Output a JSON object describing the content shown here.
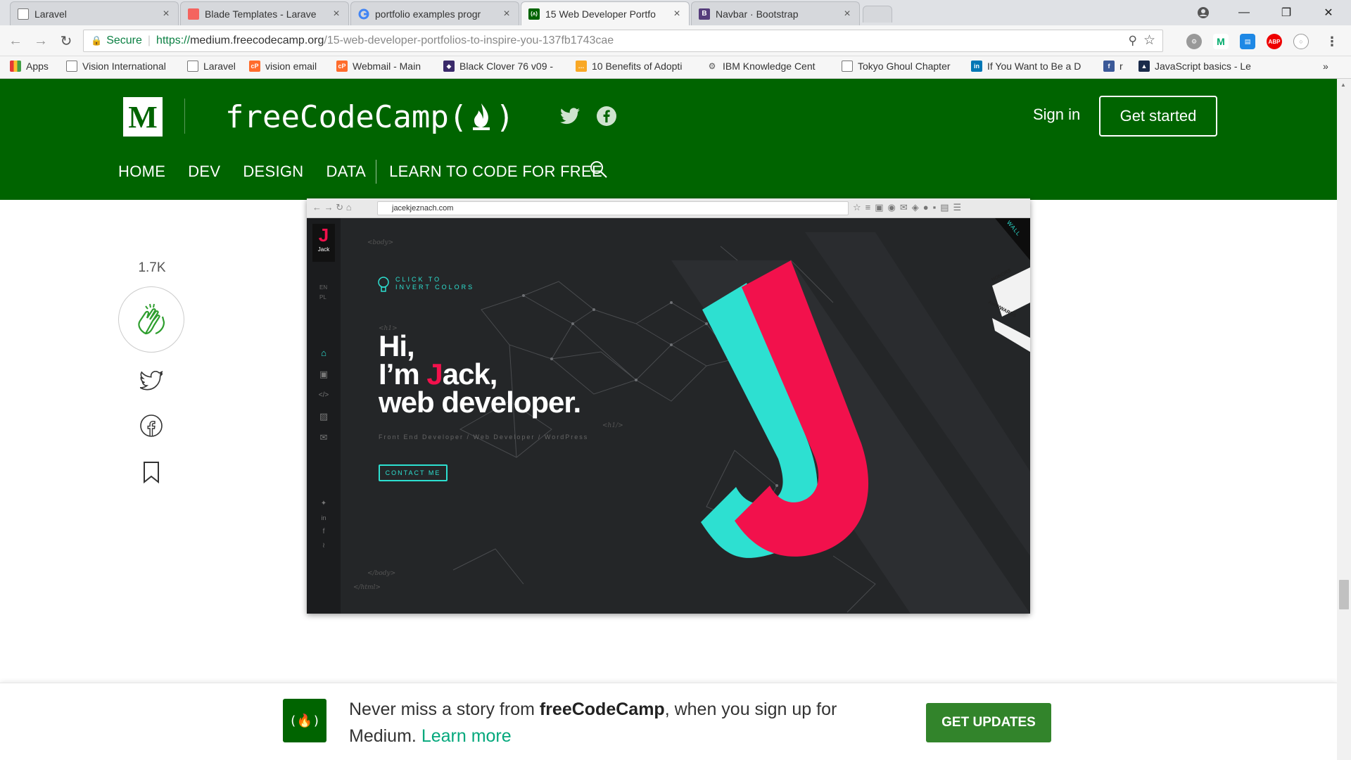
{
  "tabs": [
    {
      "title": "Laravel",
      "favicon": "page-icon"
    },
    {
      "title": "Blade Templates - Larave",
      "favicon": "laravel-icon",
      "color": "#f4645f"
    },
    {
      "title": "portfolio examples progr",
      "favicon": "google-icon"
    },
    {
      "title": "15 Web Developer Portfo",
      "favicon": "freecodecamp-icon",
      "color": "#006400",
      "active": true
    },
    {
      "title": "Navbar · Bootstrap",
      "favicon": "bootstrap-icon",
      "color": "#563d7c"
    }
  ],
  "address": {
    "secure_label": "Secure",
    "url_scheme": "https://",
    "url_domain": "medium.freecodecamp.org",
    "url_path": "/15-web-developer-portfolios-to-inspire-you-137fb1743cae"
  },
  "bookmarks": [
    {
      "label": "Apps"
    },
    {
      "label": "Vision International"
    },
    {
      "label": "Laravel"
    },
    {
      "label": "vision email"
    },
    {
      "label": "Webmail - Main"
    },
    {
      "label": "Black Clover 76 v09 -"
    },
    {
      "label": "10 Benefits of Adopti"
    },
    {
      "label": "IBM Knowledge Cent"
    },
    {
      "label": "Tokyo Ghoul Chapter"
    },
    {
      "label": "If You Want to Be a D"
    },
    {
      "label": "r"
    },
    {
      "label": "JavaScript basics - Le"
    },
    {
      "label": "»"
    }
  ],
  "header": {
    "logo_letter": "M",
    "brand": "freeCodeCamp(",
    "brand_end": ")",
    "sign_in": "Sign in",
    "get_started": "Get started",
    "menu": [
      "HOME",
      "DEV",
      "DESIGN",
      "DATA",
      "LEARN TO CODE FOR FREE"
    ],
    "colors": {
      "header_bg": "#006400"
    }
  },
  "side": {
    "clap_count": "1.7K"
  },
  "screenshot": {
    "url": "jacekjeznach.com",
    "logo_letter": "J",
    "logo_name": "Jack",
    "lang_en": "EN",
    "lang_pl": "PL",
    "invert_1": "CLICK TO",
    "invert_2": "INVERT COLORS",
    "hero_line1": "Hi,",
    "hero_line2_a": "I’m ",
    "hero_line2_j": "J",
    "hero_line2_b": "ack,",
    "hero_line3": "web developer.",
    "hero_sub": "Front End Developer / Web Developer / WordPress",
    "contact": "CONTACT ME",
    "code_body": "<body>",
    "code_h1": "<h1>",
    "code_h1_end": "<h1/>",
    "code_body_end": "</body>",
    "code_html_end": "</html>",
    "ribbon_wall": "WALL",
    "ribbon_honors": "HONORS",
    "ribbon_awwards": "AWWWARDS",
    "colors": {
      "pink": "#f2114c",
      "cyan": "#2de0d1",
      "bg": "#242628"
    }
  },
  "banner": {
    "text_a": "Never miss a story from ",
    "text_b": "freeCodeCamp",
    "text_c": ", when you sign up for Medium. ",
    "learn_more": "Learn more",
    "logo_text": "(🔥)",
    "button": "GET UPDATES"
  }
}
